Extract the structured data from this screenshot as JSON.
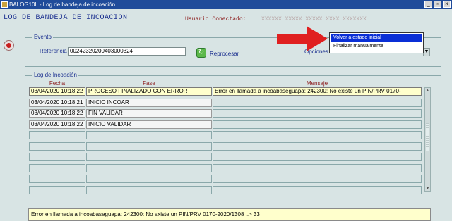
{
  "window": {
    "title": "BALOG10L - Log de bandeja de incoación"
  },
  "header": {
    "form_title": "LOG DE BANDEJA DE INCOACION",
    "user_label": "Usuario Conectado:",
    "user_value": "XXXXXX XXXXX XXXXX XXXX XXXXXXX"
  },
  "evento": {
    "legend": "Evento",
    "referencia_label": "Referencia",
    "referencia_value": "00242320200403000324",
    "reprocesar_label": "Reprocesar",
    "opciones_label": "Opciones"
  },
  "dropdown": {
    "items": [
      "Volver a estado inicial",
      "Finalizar manualmente"
    ],
    "highlighted_index": 0
  },
  "log": {
    "legend": "Log de Incoación",
    "columns": [
      "Fecha",
      "Fase",
      "Mensaje"
    ],
    "rows": [
      {
        "fecha": "03/04/2020 10:18:22",
        "fase": "PROCESO FINALIZADO CON ERROR",
        "mensaje": "Error en llamada a incoabaseguapa: 242300: No existe un PIN/PRV 0170-"
      },
      {
        "fecha": "03/04/2020 10:18:21",
        "fase": "INICIO INCOAR",
        "mensaje": ""
      },
      {
        "fecha": "03/04/2020 10:18:22",
        "fase": "FIN VALIDAR",
        "mensaje": ""
      },
      {
        "fecha": "03/04/2020 10:18:22",
        "fase": "INICIO VALIDAR",
        "mensaje": ""
      },
      {
        "fecha": "",
        "fase": "",
        "mensaje": ""
      },
      {
        "fecha": "",
        "fase": "",
        "mensaje": ""
      },
      {
        "fecha": "",
        "fase": "",
        "mensaje": ""
      },
      {
        "fecha": "",
        "fase": "",
        "mensaje": ""
      },
      {
        "fecha": "",
        "fase": "",
        "mensaje": ""
      },
      {
        "fecha": "",
        "fase": "",
        "mensaje": ""
      }
    ]
  },
  "message_bar": {
    "text": "Error en llamada a incoabaseguapa: 242300: No existe un PIN/PRV 0170-2020/1308 ..> 33"
  },
  "colors": {
    "title_bar": "#1f4b9a",
    "form_title": "#1a2f8f",
    "label_red": "#8b1a1a",
    "highlight": "#0a2fd6",
    "arrow": "#e02020",
    "selected_row": "#ffffcc"
  },
  "icons": [
    "app-icon",
    "exit-icon",
    "reprocess-icon",
    "chevron-down-icon",
    "red-arrow-annotation"
  ]
}
